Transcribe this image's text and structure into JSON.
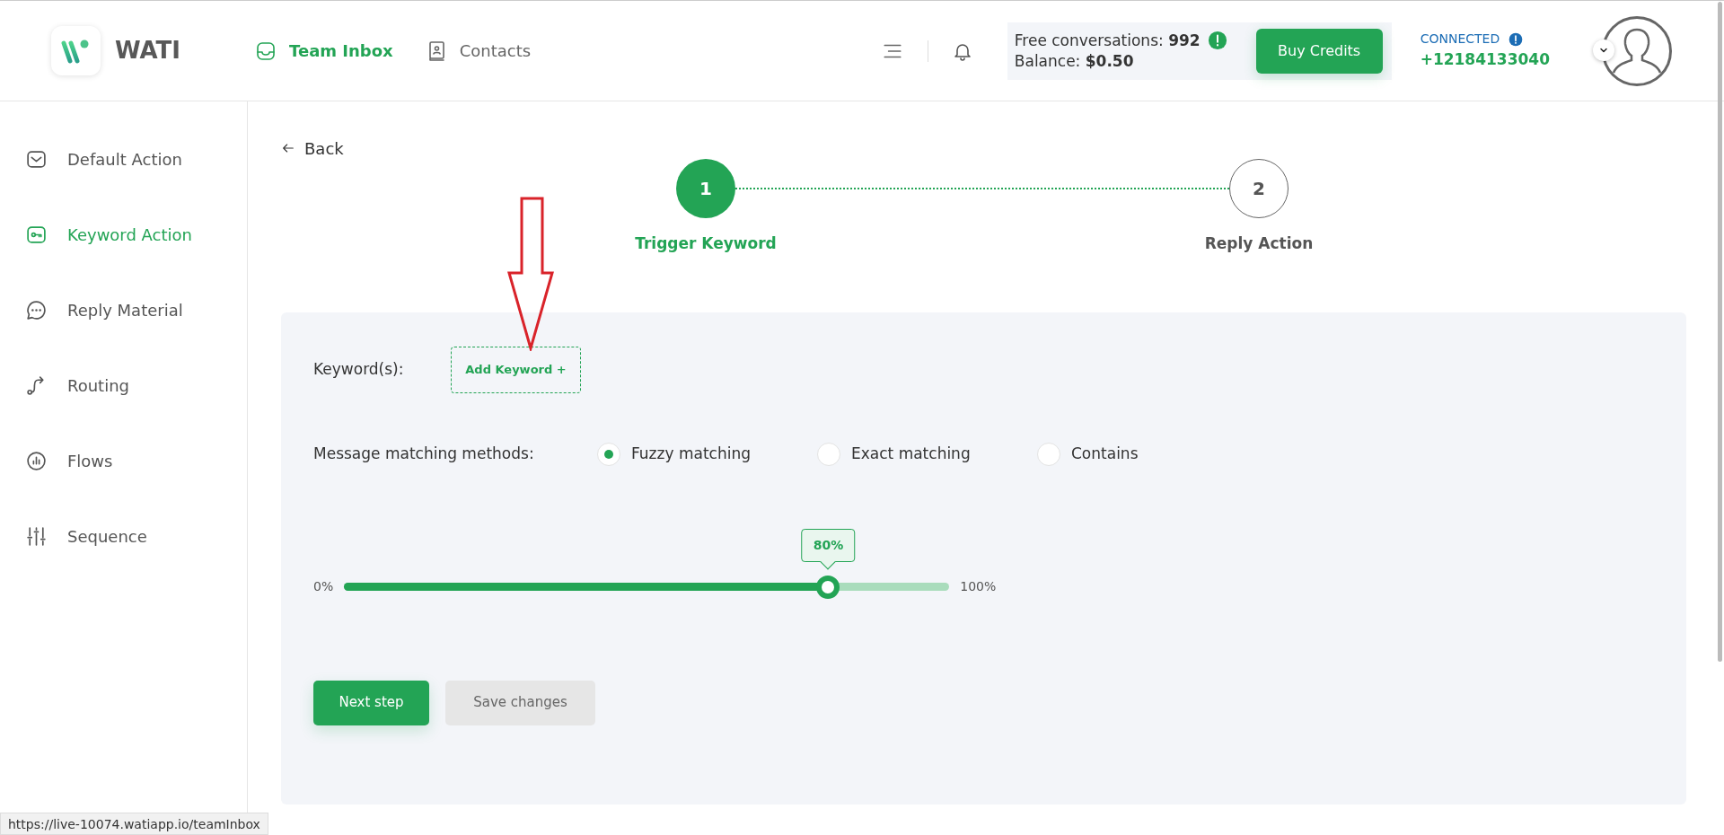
{
  "header": {
    "logo_text": "WATI",
    "nav": [
      {
        "label": "Team Inbox",
        "selected": true
      },
      {
        "label": "Contacts",
        "selected": false
      }
    ],
    "credits": {
      "free_label": "Free conversations:",
      "free_value": "992",
      "balance_label": "Balance:",
      "balance_value": "$0.50",
      "buy_button": "Buy Credits"
    },
    "connection": {
      "status": "CONNECTED",
      "phone": "+12184133040"
    }
  },
  "sidebar": {
    "items": [
      {
        "label": "Default Action",
        "selected": false
      },
      {
        "label": "Keyword Action",
        "selected": true
      },
      {
        "label": "Reply Material",
        "selected": false
      },
      {
        "label": "Routing",
        "selected": false
      },
      {
        "label": "Flows",
        "selected": false
      },
      {
        "label": "Sequence",
        "selected": false
      }
    ]
  },
  "back": "Back",
  "stepper": [
    {
      "number": "1",
      "label": "Trigger Keyword",
      "selected": true
    },
    {
      "number": "2",
      "label": "Reply Action",
      "selected": false
    }
  ],
  "form": {
    "keywords_label": "Keyword(s):",
    "add_keyword_button": "Add Keyword +",
    "matching_label": "Message matching methods:",
    "methods": [
      {
        "label": "Fuzzy matching",
        "selected": true
      },
      {
        "label": "Exact matching",
        "selected": false
      },
      {
        "label": "Contains",
        "selected": false
      }
    ],
    "slider": {
      "min_label": "0%",
      "max_label": "100%",
      "value_label": "80%",
      "level": 0.8
    }
  },
  "buttons": [
    {
      "label": "Next step",
      "kind": "primary"
    },
    {
      "label": "Save changes",
      "kind": "secondary"
    }
  ],
  "status_url": "https://live-10074.watiapp.io/teamInbox"
}
